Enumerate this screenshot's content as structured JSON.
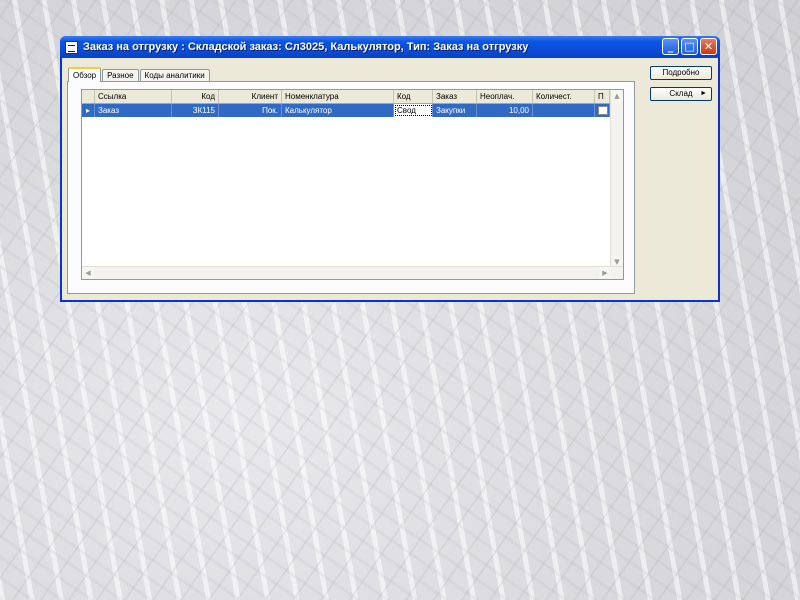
{
  "window": {
    "title": "Заказ на отгрузку : Складской заказ: Сл3025, Калькулятор, Тип: Заказ на отгрузку",
    "minimize_glyph": "_",
    "maximize_glyph": "□",
    "close_glyph": "✕"
  },
  "tabs": [
    {
      "label": "Обзор"
    },
    {
      "label": "Разное"
    },
    {
      "label": "Коды аналитики"
    }
  ],
  "grid": {
    "columns": [
      "Ссылка",
      "Код",
      "Клиент",
      "Номенклатура",
      "Код",
      "Заказ",
      "Неоплач.",
      "Количест.",
      "П"
    ],
    "rows": [
      {
        "indicator": "▸",
        "cells": [
          "Заказ",
          "ЗК115",
          "Пок.",
          "Калькулятор",
          "Свод",
          "Закупки",
          "10,00",
          "",
          ""
        ]
      }
    ]
  },
  "side_buttons": {
    "details": "Подробно",
    "warehouse": "Склад"
  },
  "colors": {
    "titlebar": "#0a4bd6",
    "selection": "#316ac5",
    "window_bg": "#ece9d8"
  }
}
